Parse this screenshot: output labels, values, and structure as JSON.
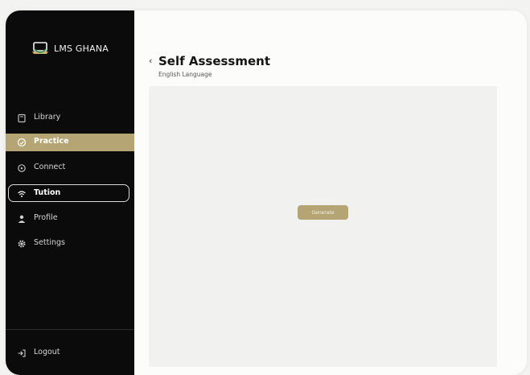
{
  "app": {
    "brand": "LMS GHANA"
  },
  "sidebar": {
    "items": [
      {
        "label": "Library",
        "icon": "library-icon",
        "state": "normal"
      },
      {
        "label": "Practice",
        "icon": "practice-icon",
        "state": "active"
      },
      {
        "label": "Connect",
        "icon": "connect-icon",
        "state": "normal"
      },
      {
        "label": "Tution",
        "icon": "wifi-icon",
        "state": "outlined"
      },
      {
        "label": "Profile",
        "icon": "profile-icon",
        "state": "normal"
      },
      {
        "label": "Settings",
        "icon": "gear-icon",
        "state": "normal"
      }
    ],
    "logout": {
      "label": "Logout",
      "icon": "logout-icon"
    }
  },
  "header": {
    "back_icon": "chevron-left-icon",
    "title": "Self Assessment",
    "subtitle": "English Language"
  },
  "panel": {
    "generate_label": "Generate"
  },
  "colors": {
    "accent": "#b5a574",
    "sidebar_bg": "#0b0b0b",
    "panel_bg": "#f1f2f0"
  }
}
